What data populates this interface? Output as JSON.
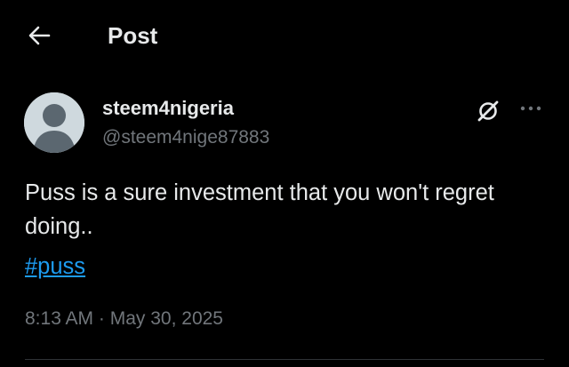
{
  "header": {
    "back_icon": "arrow-left-icon",
    "title": "Post"
  },
  "post": {
    "author": {
      "display_name": "steem4nigeria",
      "handle": "@steem4nige87883",
      "avatar_icon": "default-user-avatar"
    },
    "actions": {
      "grok_icon": "grok-icon",
      "more_icon": "more-horizontal-icon"
    },
    "text": "Puss is a sure investment that you won't regret doing..",
    "hashtag": "#puss",
    "time": "8:13 AM",
    "separator": " · ",
    "date": "May 30, 2025"
  },
  "colors": {
    "background": "#000000",
    "primary_text": "#e7e9ea",
    "secondary_text": "#71767b",
    "link": "#1d9bf0",
    "divider": "#2f3336"
  }
}
